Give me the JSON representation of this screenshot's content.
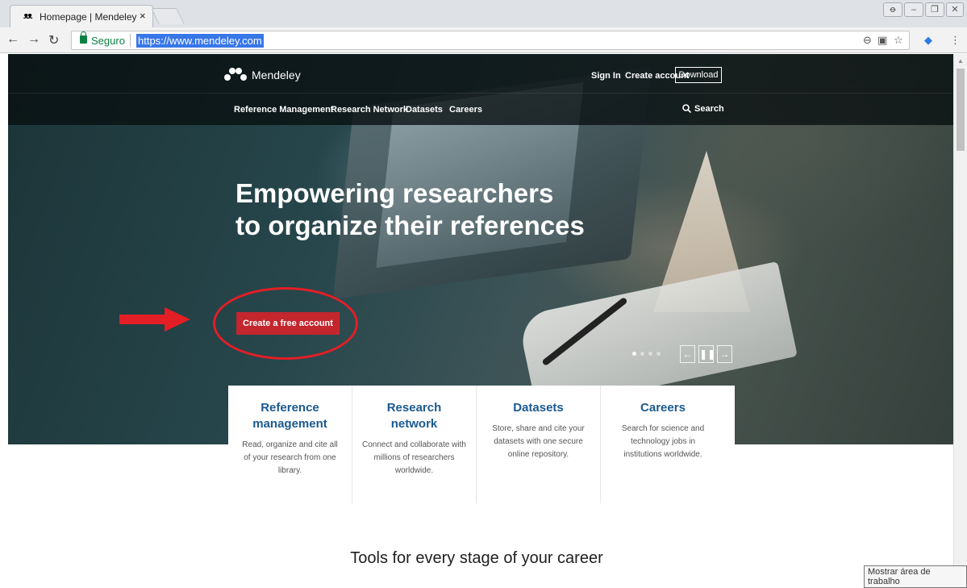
{
  "browser": {
    "tab_title": "Homepage | Mendeley",
    "tab_close": "×",
    "secure_label": "Seguro",
    "url": "https://www.mendeley.com"
  },
  "nav": {
    "logo_text": "Mendeley",
    "sign_in": "Sign In",
    "create_account": "Create account",
    "download": "Download",
    "links": [
      "Reference Management",
      "Research Network",
      "Datasets",
      "Careers"
    ],
    "search": "Search"
  },
  "hero": {
    "headline_line1": "Empowering researchers",
    "headline_line2": "to organize their references",
    "cta": "Create a free account",
    "slide_count": 4,
    "active_slide": 1
  },
  "cards": [
    {
      "title": "Reference management",
      "desc": "Read, organize and cite all of your research from one library."
    },
    {
      "title": "Research network",
      "desc": "Connect and collaborate with millions of researchers worldwide."
    },
    {
      "title": "Datasets",
      "desc": "Store, share and cite your datasets with one secure online repository."
    },
    {
      "title": "Careers",
      "desc": "Search for science and technology jobs in institutions worldwide."
    }
  ],
  "tools_title": "Tools for every stage of your career",
  "taskbar_tooltip": "Mostrar área de trabalho",
  "colors": {
    "cta_red": "#c4262e",
    "annotation_red": "#e41e25",
    "card_title_blue": "#1b5a91"
  }
}
